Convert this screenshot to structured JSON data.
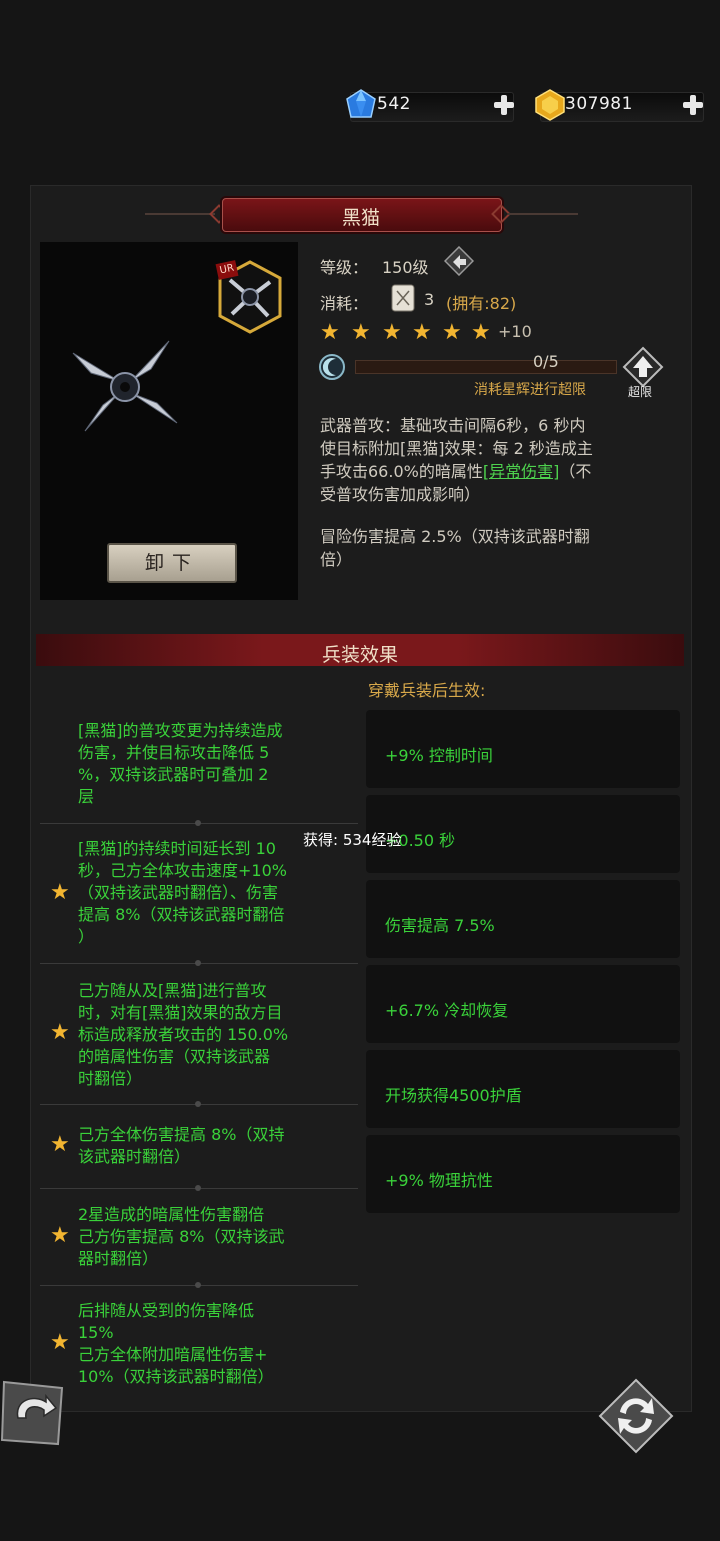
{
  "currency": {
    "gems": "542",
    "gold": "307981"
  },
  "weapon": {
    "name": "黑猫",
    "rarity_badge": "UR",
    "level_label": "等级：",
    "level_value": "150级",
    "cost_label": "消耗：",
    "cost_value": "3",
    "owned": "(拥有:82)",
    "stars": 6,
    "star_bonus": "+10",
    "progress_text": "0/5",
    "progress_fraction": 0.0,
    "progress_hint": "消耗星辉进行超限",
    "breakthrough_label": "超限",
    "unequip_label": "卸下",
    "desc_line1": "武器普攻：基础攻击间隔6秒，6 秒内",
    "desc_line2": "使目标附加[黑猫]效果：每 2 秒造成主",
    "desc_line3_pre": "手攻击66.0%的暗属性",
    "desc_link": "[异常伤害]",
    "desc_line3_post": "（不",
    "desc_line4": "受普攻伤害加成影响）",
    "adv_line1": "冒险伤害提高 2.5%（双持该武器时翻",
    "adv_line2": "倍）"
  },
  "equip_section": {
    "title": "兵装效果",
    "subtitle": "穿戴兵装后生效:",
    "effects": [
      {
        "lines": [
          "[黑猫]的普攻变更为持续造成",
          "伤害，并使目标攻击降低 5",
          "%，双持该武器时可叠加 2",
          "层"
        ],
        "star": false
      },
      {
        "lines": [
          "[黑猫]的持续时间延长到 10",
          "秒，己方全体攻击速度+10%",
          "（双持该武器时翻倍）、伤害",
          "提高 8%（双持该武器时翻倍",
          "）"
        ],
        "star": true
      },
      {
        "lines": [
          "己方随从及[黑猫]进行普攻",
          "时，对有[黑猫]效果的敌方目",
          "标造成释放者攻击的 150.0%",
          "的暗属性伤害（双持该武器",
          "时翻倍）"
        ],
        "star": true
      },
      {
        "lines": [
          "己方全体伤害提高 8%（双持",
          "该武器时翻倍）"
        ],
        "star": true
      },
      {
        "lines": [
          "2星造成的暗属性伤害翻倍",
          "己方伤害提高 8%（双持该武",
          "器时翻倍）"
        ],
        "star": true
      },
      {
        "lines": [
          "后排随从受到的伤害降低",
          "15%",
          "己方全体附加暗属性伤害+",
          "10%（双持该武器时翻倍）"
        ],
        "star": true
      }
    ],
    "bonuses": [
      "+9% 控制时间",
      "+0.50 秒",
      "伤害提高 7.5%",
      "+6.7% 冷却恢复",
      "开场获得4500护盾",
      "+9% 物理抗性"
    ]
  },
  "toast": "获得: 534经验",
  "colors": {
    "accent_red": "#7a181b",
    "effect_green": "#3ad23a",
    "star_gold": "#f2b531"
  }
}
